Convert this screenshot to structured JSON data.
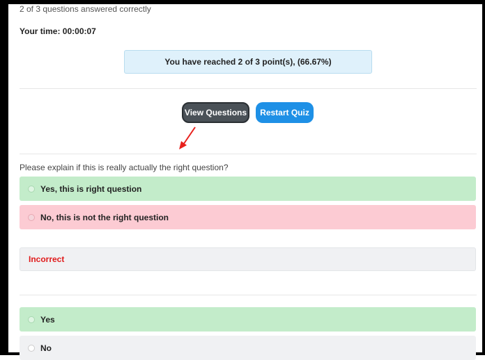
{
  "results": {
    "summary": "2 of 3 questions answered correctly",
    "time_label": "Your time:",
    "time_value": "00:00:07",
    "points_message": "You have reached 2 of 3 point(s), (66.67%)"
  },
  "actions": {
    "view_questions": "View Questions",
    "restart_quiz": "Restart Quiz"
  },
  "question": {
    "text": "Please explain if this is really actually the right question?",
    "answers": [
      {
        "label": "Yes, this is right question",
        "state": "correct"
      },
      {
        "label": "No, this is not the right question",
        "state": "incorrect-selected"
      }
    ],
    "feedback": "Incorrect"
  },
  "next_question": {
    "answers": [
      {
        "label": "Yes",
        "state": "correct"
      },
      {
        "label": "No",
        "state": "neutral"
      }
    ]
  },
  "colors": {
    "correct_bg": "#c3ecca",
    "incorrect_bg": "#fccbd3",
    "feedback_text": "#e01b1b",
    "restart_button": "#1e90e6",
    "view_button": "#4a5157",
    "annotation_arrow": "#e8201c"
  }
}
